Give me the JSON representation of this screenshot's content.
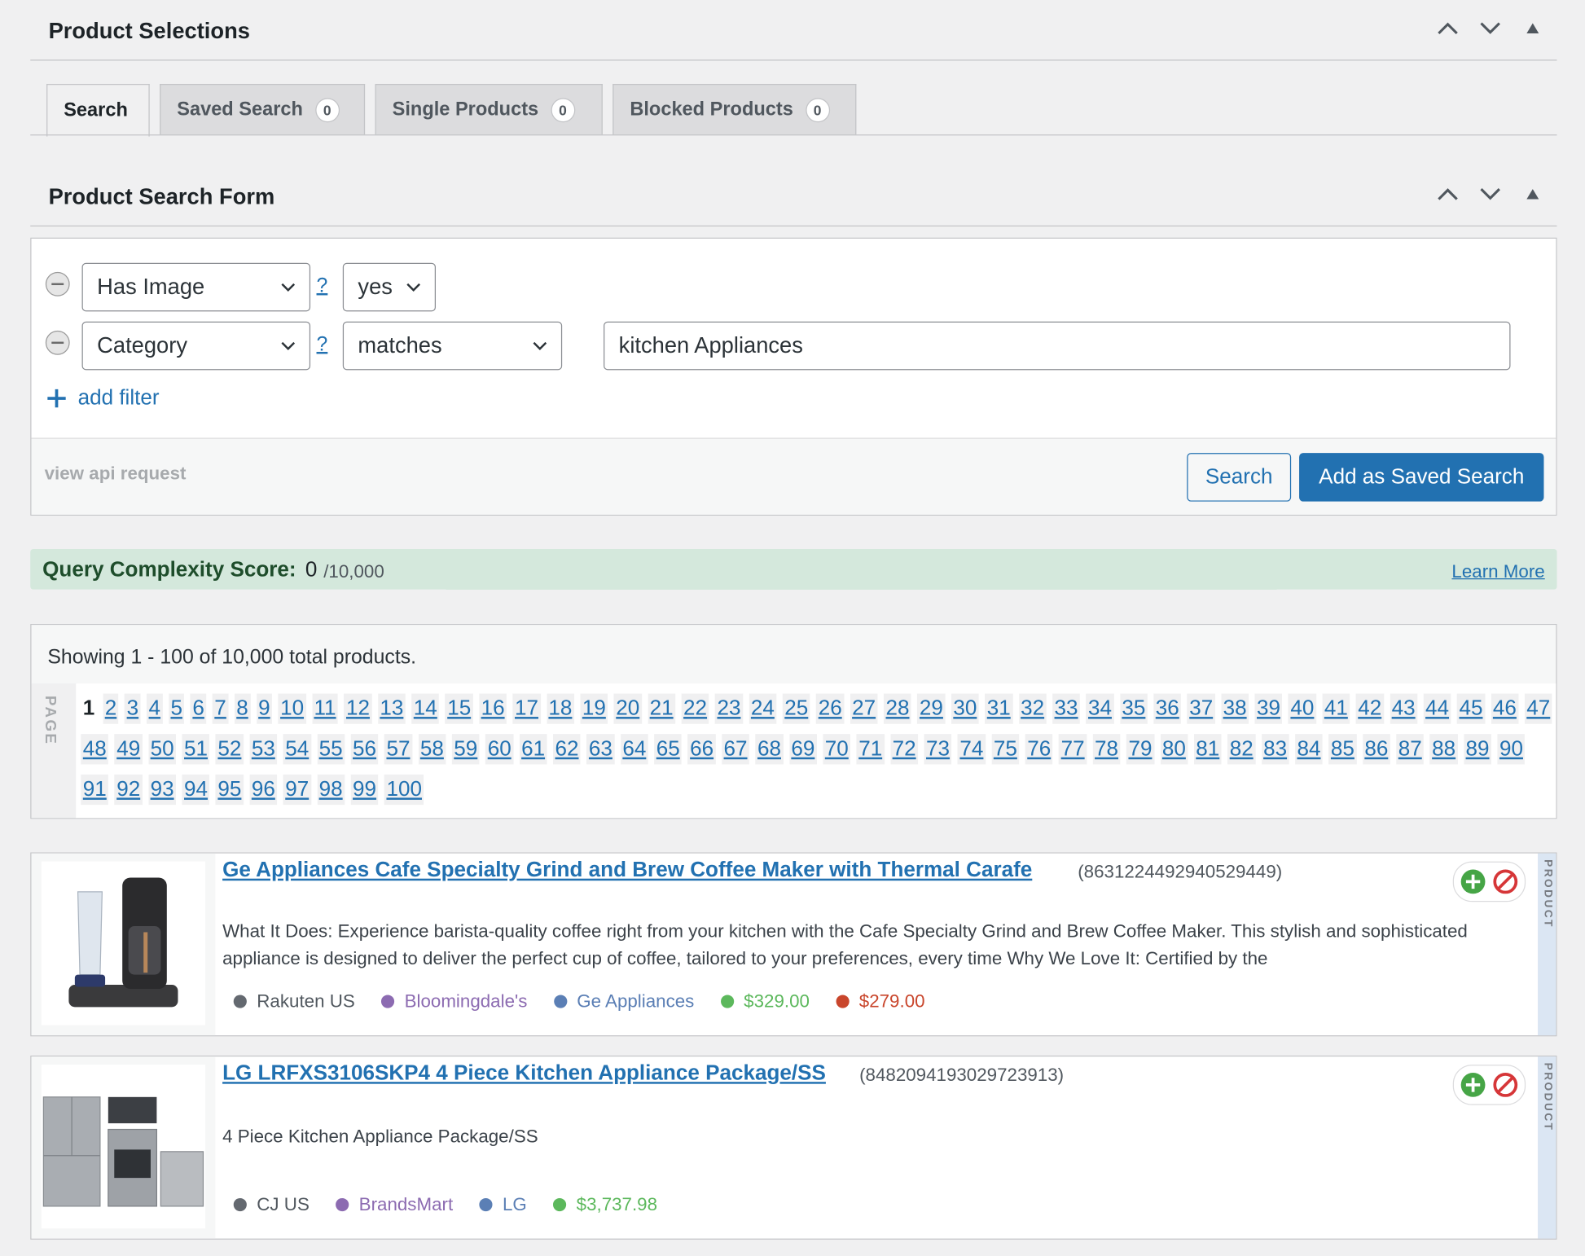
{
  "panels": {
    "product_selections": "Product Selections",
    "search_form": "Product Search Form"
  },
  "tabs": [
    {
      "label": "Search",
      "count": ""
    },
    {
      "label": "Saved Search",
      "count": "0"
    },
    {
      "label": "Single Products",
      "count": "0"
    },
    {
      "label": "Blocked Products",
      "count": "0"
    }
  ],
  "filters": {
    "row1": {
      "field": "Has Image",
      "help": "?",
      "operator": "yes"
    },
    "row2": {
      "field": "Category",
      "help": "?",
      "operator": "matches",
      "value": "kitchen Appliances"
    },
    "add_filter": "add filter"
  },
  "form_footer": {
    "view_api": "view api request",
    "search_btn": "Search",
    "save_btn": "Add as Saved Search"
  },
  "complexity": {
    "label": "Query Complexity Score:",
    "score": "0",
    "max": "/10,000",
    "learn_more": "Learn More"
  },
  "results": {
    "showing": "Showing 1 - 100 of 10,000 total products.",
    "page_label": "PAGE",
    "current_page": 1,
    "total_pages": 100
  },
  "products": [
    {
      "title": "Ge Appliances Cafe Specialty Grind and Brew Coffee Maker with Thermal Carafe",
      "id": "(8631224492940529449)",
      "description": "What It Does: Experience barista-quality coffee right from your kitchen with the Cafe Specialty Grind and Brew Coffee Maker. This stylish and sophisticated appliance is designed to deliver the perfect cup of coffee, tailored to your preferences, every time Why We Love It: Certified by the",
      "network": "Rakuten US",
      "merchant": "Bloomingdale's",
      "brand": "Ge Appliances",
      "price": "$329.00",
      "sale_price": "$279.00",
      "side_label": "PRODUCT"
    },
    {
      "title": "LG LRFXS3106SKP4 4 Piece Kitchen Appliance Package/SS",
      "id": "(8482094193029723913)",
      "description": "4 Piece Kitchen Appliance Package/SS",
      "network": "CJ US",
      "merchant": "BrandsMart",
      "brand": "LG",
      "price": "$3,737.98",
      "side_label": "PRODUCT"
    }
  ],
  "colors": {
    "link": "#2271b1",
    "primary_btn": "#2271b1",
    "complexity_bg": "#d4e8dc",
    "network_dot": "#646970",
    "merchant": "#8c6bb1",
    "brand": "#5b7fb5",
    "price": "#5cb85c",
    "sale_price": "#c9462c"
  },
  "icons": [
    "chevron-up-icon",
    "chevron-down-icon",
    "triangle-up-icon",
    "chevron-down-icon",
    "minus-circle-icon",
    "plus-icon",
    "add-circle-icon",
    "block-icon"
  ]
}
